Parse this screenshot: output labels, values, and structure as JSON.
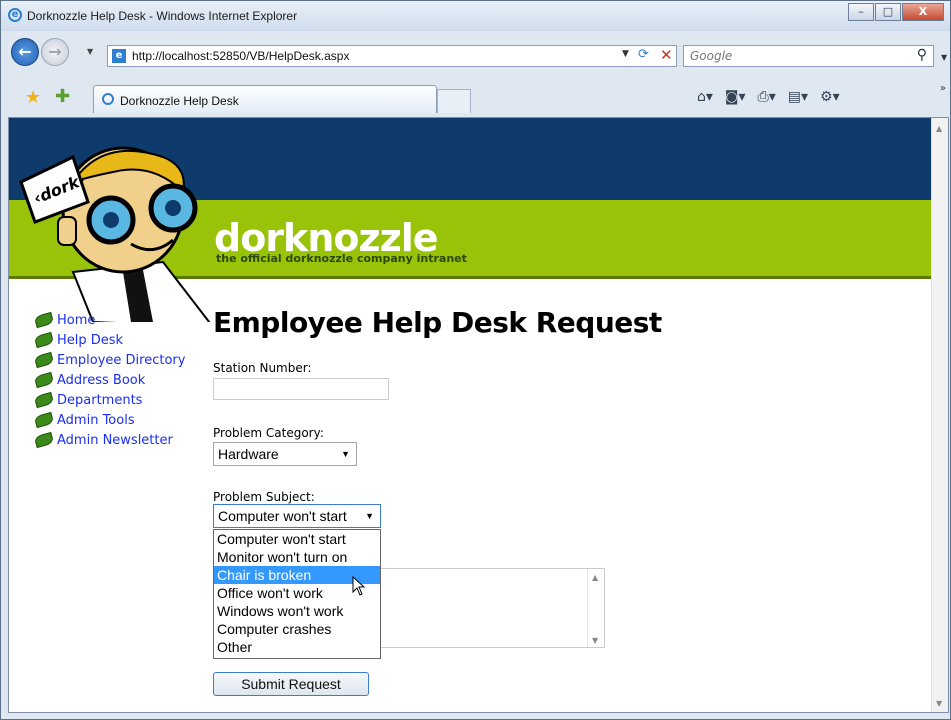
{
  "window": {
    "title": "Dorknozzle Help Desk - Windows Internet Explorer",
    "minimize": "–",
    "maximize": "□",
    "close": "X"
  },
  "address_bar": {
    "url": "http://localhost:52850/VB/HelpDesk.aspx",
    "search_placeholder": "Google"
  },
  "tab": {
    "label": "Dorknozzle Help Desk"
  },
  "site": {
    "brand": "dorknozzle",
    "tagline": "the official dorknozzle company intranet",
    "logo_sign": "‹dork›",
    "nav": [
      {
        "label": "Home"
      },
      {
        "label": "Help Desk"
      },
      {
        "label": "Employee Directory"
      },
      {
        "label": "Address Book"
      },
      {
        "label": "Departments"
      },
      {
        "label": "Admin Tools"
      },
      {
        "label": "Admin Newsletter"
      }
    ]
  },
  "form": {
    "heading": "Employee Help Desk Request",
    "station_label": "Station Number:",
    "station_value": "",
    "category_label": "Problem Category:",
    "category_value": "Hardware",
    "subject_label": "Problem Subject:",
    "subject_value": "Computer won't start",
    "subject_options": [
      "Computer won't start",
      "Monitor won't turn on",
      "Chair is broken",
      "Office won't work",
      "Windows won't work",
      "Computer crashes",
      "Other"
    ],
    "highlighted_option": "Chair is broken",
    "submit_label": "Submit Request"
  },
  "colors": {
    "header_dark": "#0e3b6b",
    "header_green": "#99c308",
    "link": "#1a2ff0",
    "selection": "#3399ff"
  }
}
